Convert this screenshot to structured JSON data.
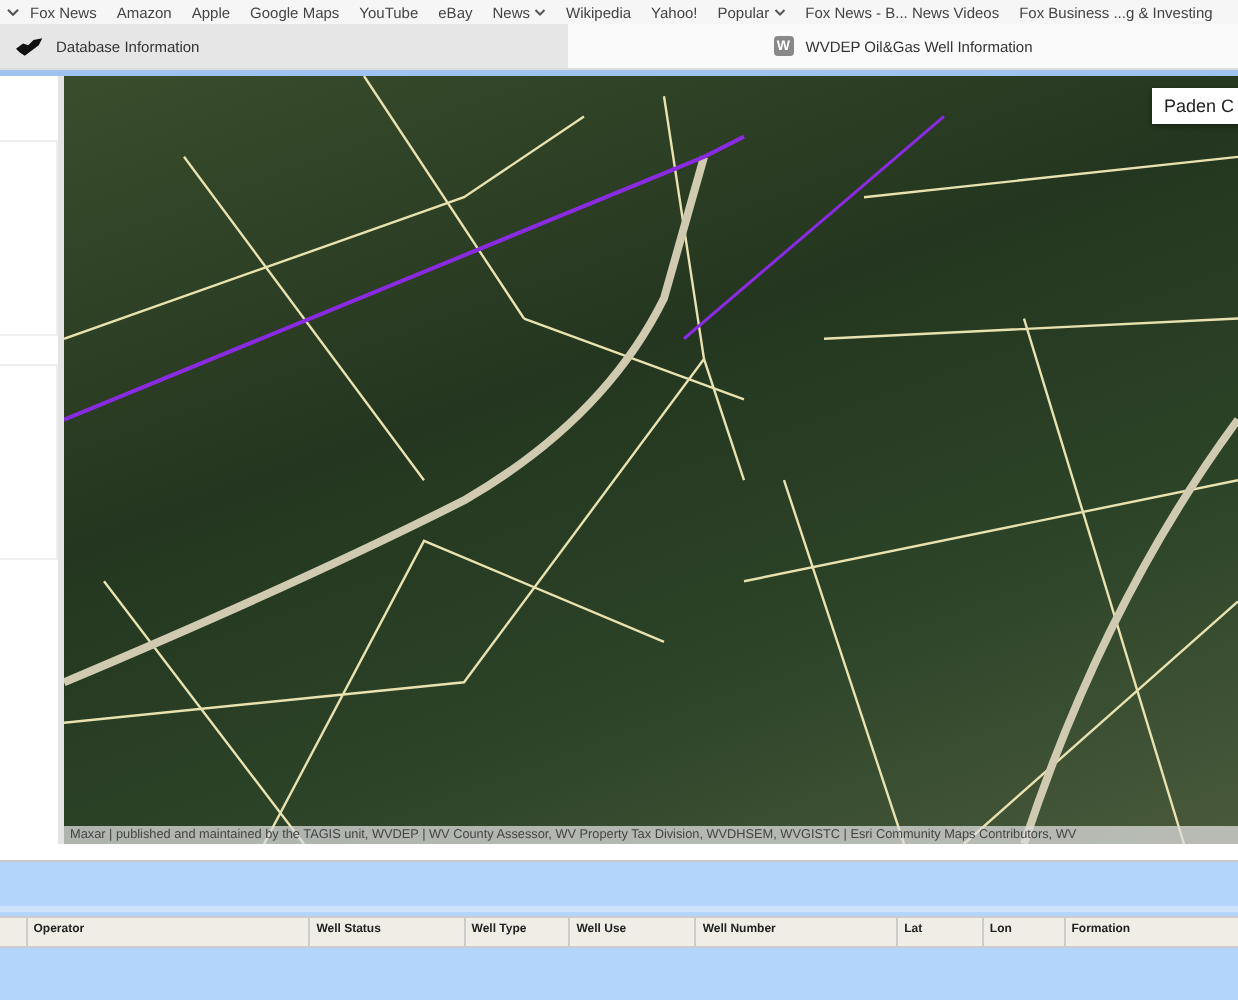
{
  "bookmarks": [
    {
      "label": "Fox News",
      "dropdown": false
    },
    {
      "label": "Amazon",
      "dropdown": false
    },
    {
      "label": "Apple",
      "dropdown": false
    },
    {
      "label": "Google Maps",
      "dropdown": false
    },
    {
      "label": "YouTube",
      "dropdown": false
    },
    {
      "label": "eBay",
      "dropdown": false
    },
    {
      "label": "News",
      "dropdown": true
    },
    {
      "label": "Wikipedia",
      "dropdown": false
    },
    {
      "label": "Yahoo!",
      "dropdown": false
    },
    {
      "label": "Popular",
      "dropdown": true
    },
    {
      "label": "Fox News - B... News Videos",
      "dropdown": false
    },
    {
      "label": "Fox Business ...g & Investing",
      "dropdown": false
    }
  ],
  "tabs": [
    {
      "title": "Database Information",
      "kind": "state",
      "selected": true
    },
    {
      "title": "WVDEP Oil&Gas Well Information",
      "kind": "letter",
      "icon_text": "W",
      "selected": false
    }
  ],
  "map": {
    "popup": "Paden C",
    "attribution": "Maxar | published and maintained by the TAGIS unit, WVDEP | WV County Assessor, WV Property Tax Division, WVDHSEM, WVGISTC | Esri Community Maps Contributors, WV"
  },
  "table": {
    "columns": [
      "Operator",
      "Well Status",
      "Well Type",
      "Well Use",
      "Well Number",
      "Lat",
      "Lon",
      "Formation"
    ]
  }
}
